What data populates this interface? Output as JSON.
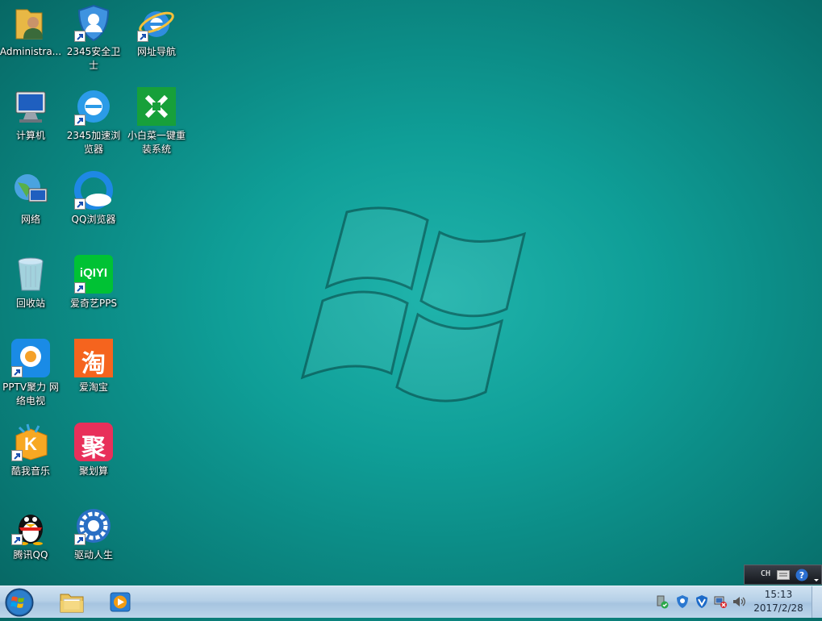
{
  "desktop": {
    "icons": [
      {
        "label": "Administra...",
        "icon": "user-folder-icon"
      },
      {
        "label": "2345安全卫士",
        "icon": "shield-icon"
      },
      {
        "label": "网址导航",
        "icon": "ie-icon"
      },
      {
        "label": "计算机",
        "icon": "computer-icon"
      },
      {
        "label": "2345加速浏览器",
        "icon": "browser-e-icon"
      },
      {
        "label": "小白菜一键重装系统",
        "icon": "reinstall-icon"
      },
      {
        "label": "网络",
        "icon": "network-icon"
      },
      {
        "label": "QQ浏览器",
        "icon": "qq-browser-icon"
      },
      {
        "label": "回收站",
        "icon": "recycle-bin-icon"
      },
      {
        "label": "爱奇艺PPS",
        "icon": "iqiyi-icon",
        "text": "iQIYI"
      },
      {
        "label": "PPTV聚力 网络电视",
        "icon": "pptv-icon"
      },
      {
        "label": "爱淘宝",
        "icon": "taobao-icon",
        "text": "淘"
      },
      {
        "label": "酷我音乐",
        "icon": "kuwo-icon",
        "text": "K"
      },
      {
        "label": "聚划算",
        "icon": "juhuasuan-icon",
        "text": "聚"
      },
      {
        "label": "腾讯QQ",
        "icon": "qq-penguin-icon"
      },
      {
        "label": "驱动人生",
        "icon": "driver-gear-icon"
      }
    ]
  },
  "langbar": {
    "lang": "CH"
  },
  "clock": {
    "time": "15:13",
    "date": "2017/2/28"
  },
  "colors": {
    "accent": "#0fa59d",
    "taskbar": "#b6d0e7"
  }
}
